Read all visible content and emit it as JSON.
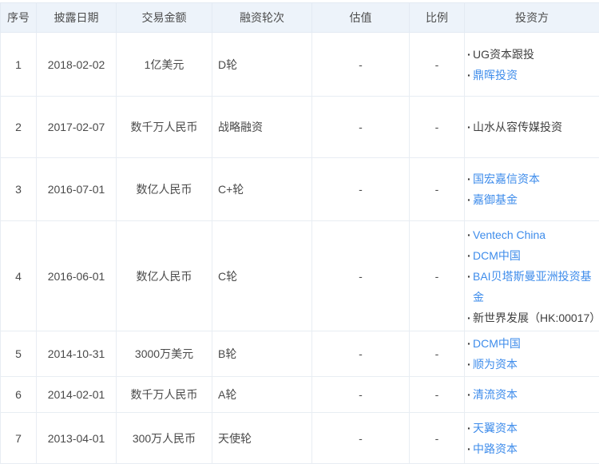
{
  "table": {
    "bullet": "·",
    "colors": {
      "header_bg": "#edf3fa",
      "link_blue": "#3e8ceb",
      "text": "#4a4a4a",
      "border": "#e8edf3"
    },
    "columns": [
      {
        "key": "no",
        "label": "序号"
      },
      {
        "key": "date",
        "label": "披露日期"
      },
      {
        "key": "amount",
        "label": "交易金额"
      },
      {
        "key": "round",
        "label": "融资轮次"
      },
      {
        "key": "valuation",
        "label": "估值"
      },
      {
        "key": "ratio",
        "label": "比例"
      },
      {
        "key": "investors",
        "label": "投资方"
      }
    ],
    "rows": [
      {
        "no": "1",
        "date": "2018-02-02",
        "amount": "1亿美元",
        "round": "D轮",
        "valuation": "-",
        "ratio": "-",
        "investors": [
          {
            "name": "UG资本跟投",
            "link": false
          },
          {
            "name": "鼎晖投资",
            "link": true
          }
        ]
      },
      {
        "no": "2",
        "date": "2017-02-07",
        "amount": "数千万人民币",
        "round": "战略融资",
        "valuation": "-",
        "ratio": "-",
        "investors": [
          {
            "name": "山水从容传媒投资",
            "link": false
          }
        ]
      },
      {
        "no": "3",
        "date": "2016-07-01",
        "amount": "数亿人民币",
        "round": "C+轮",
        "valuation": "-",
        "ratio": "-",
        "investors": [
          {
            "name": "国宏嘉信资本",
            "link": true
          },
          {
            "name": "嘉御基金",
            "link": true
          }
        ]
      },
      {
        "no": "4",
        "date": "2016-06-01",
        "amount": "数亿人民币",
        "round": "C轮",
        "valuation": "-",
        "ratio": "-",
        "investors": [
          {
            "name": "Ventech China",
            "link": true
          },
          {
            "name": "DCM中国",
            "link": true
          },
          {
            "name": "BAI贝塔斯曼亚洲投资基金",
            "link": true
          },
          {
            "name": "新世界发展（HK:00017）",
            "link": false
          }
        ]
      },
      {
        "no": "5",
        "date": "2014-10-31",
        "amount": "3000万美元",
        "round": "B轮",
        "valuation": "-",
        "ratio": "-",
        "investors": [
          {
            "name": "DCM中国",
            "link": true
          },
          {
            "name": "顺为资本",
            "link": true
          }
        ]
      },
      {
        "no": "6",
        "date": "2014-02-01",
        "amount": "数千万人民币",
        "round": "A轮",
        "valuation": "-",
        "ratio": "-",
        "investors": [
          {
            "name": "清流资本",
            "link": true
          }
        ]
      },
      {
        "no": "7",
        "date": "2013-04-01",
        "amount": "300万人民币",
        "round": "天使轮",
        "valuation": "-",
        "ratio": "-",
        "investors": [
          {
            "name": "天翼资本",
            "link": true
          },
          {
            "name": "中路资本",
            "link": true
          }
        ]
      }
    ]
  }
}
